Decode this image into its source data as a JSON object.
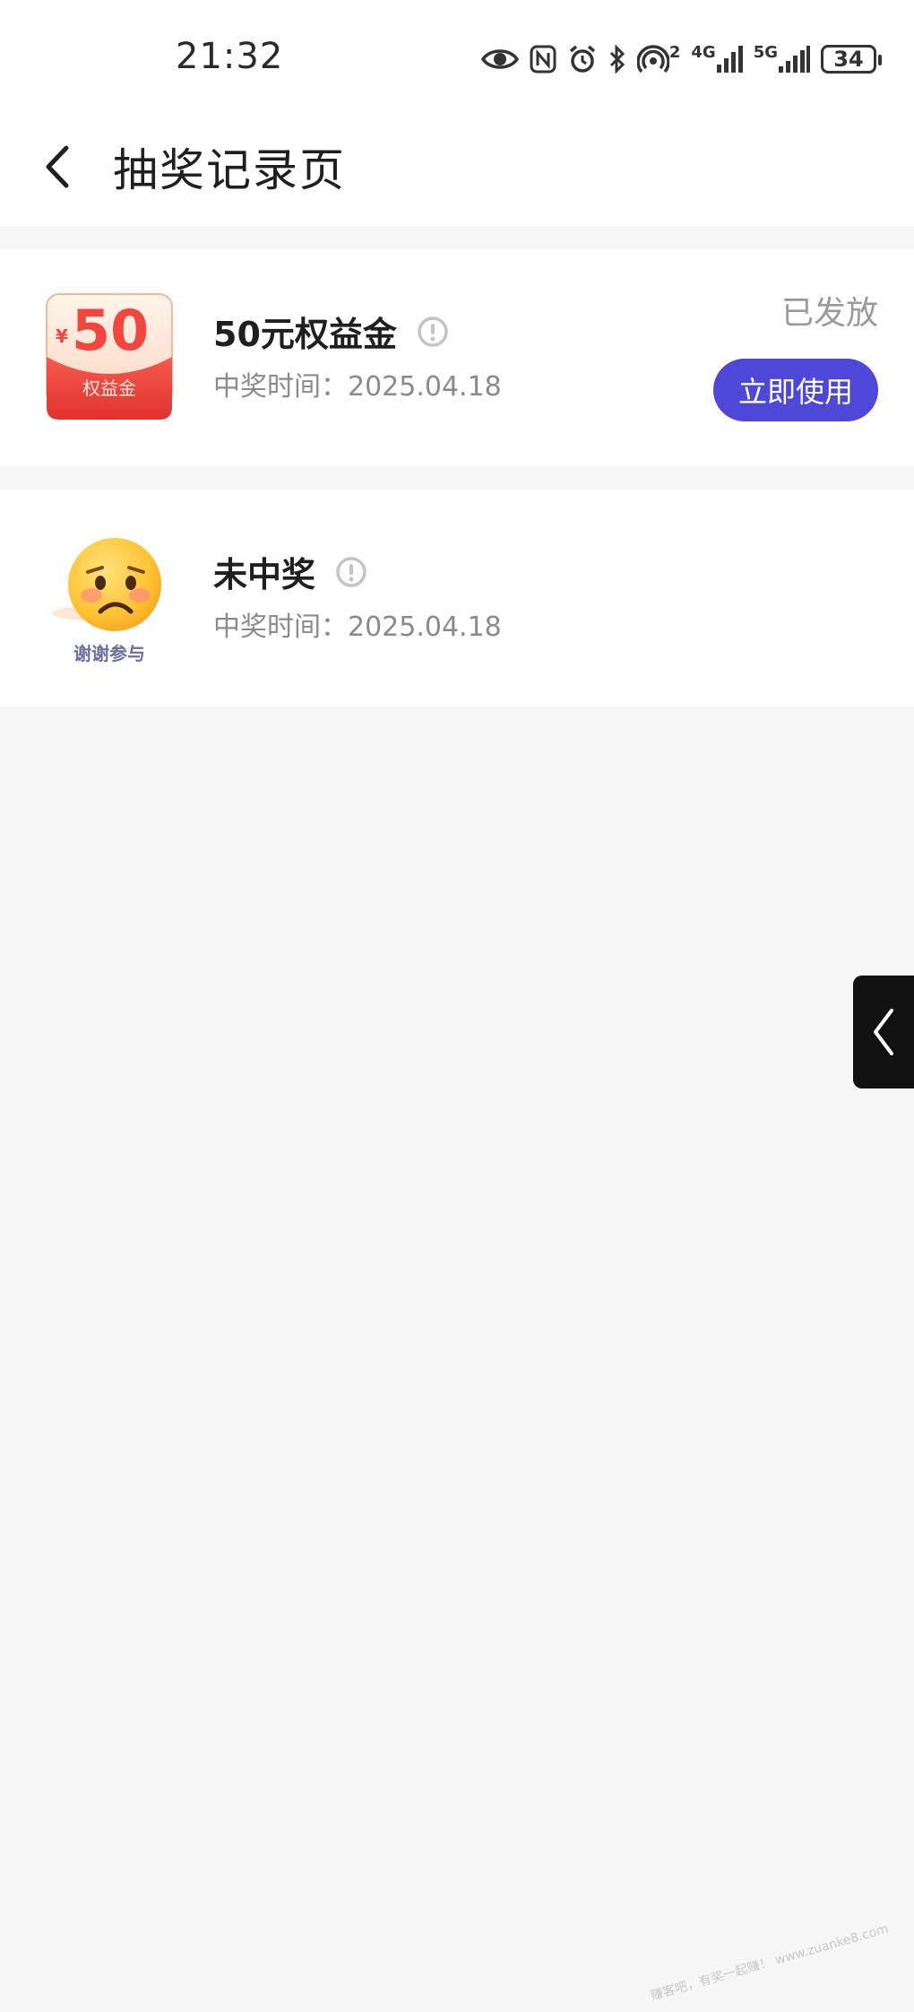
{
  "status_bar": {
    "time": "21:32",
    "signal_1_label": "4G",
    "signal_2_label": "5G",
    "hotspot_count": "2",
    "battery_level": "34",
    "icons": [
      "eye-icon",
      "nfc-icon",
      "alarm-icon",
      "bluetooth-icon",
      "hotspot-icon",
      "signal-icon",
      "signal-icon",
      "battery-icon"
    ]
  },
  "header": {
    "title": "抽奖记录页",
    "back_icon": "chevron-left-icon"
  },
  "records": [
    {
      "title": "50元权益金",
      "time_label": "中奖时间：2025.04.18",
      "status": "已发放",
      "action_label": "立即使用",
      "thumb": {
        "currency": "¥",
        "amount": "50",
        "caption": "权益金",
        "colors": {
          "body": "#ef4a45",
          "top": "#fde6d6",
          "amount": "#f0463f"
        }
      }
    },
    {
      "title": "未中奖",
      "time_label": "中奖时间：2025.04.18",
      "thumb": {
        "caption": "谢谢参与",
        "colors": {
          "face": "#ffc233",
          "caption": "#6b6f9c"
        }
      }
    }
  ],
  "side_tab": {
    "icon": "chevron-left-icon"
  },
  "watermark": "赚客吧，有奖一起赚！ www.zuanke8.com",
  "colors": {
    "accent": "#4f47d8",
    "background": "#f6f6f6",
    "muted_text": "#8a8a8a"
  }
}
